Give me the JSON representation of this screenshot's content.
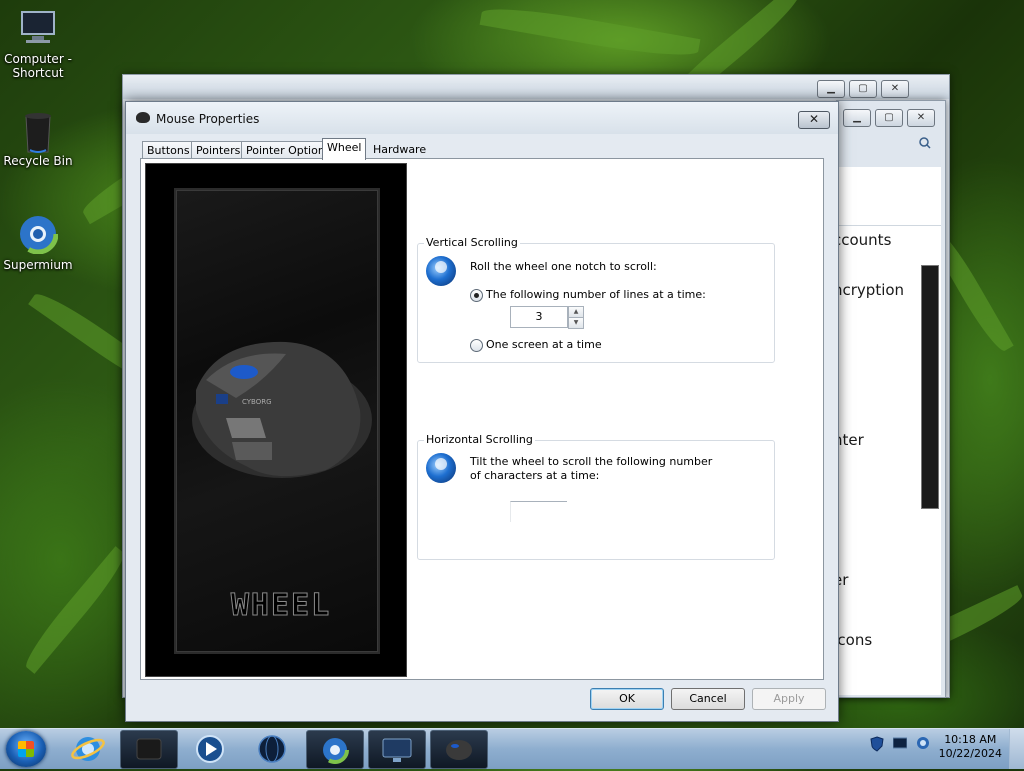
{
  "desktop": {
    "icons": [
      {
        "label": "Computer - Shortcut",
        "icon": "computer-icon"
      },
      {
        "label": "Recycle Bin",
        "icon": "recycle-bin-icon"
      },
      {
        "label": "Supermium",
        "icon": "supermium-icon"
      }
    ]
  },
  "background_window": {
    "visible_fragments": [
      "ccounts",
      "ncryption",
      "nter",
      "er",
      "Icons"
    ]
  },
  "dialog": {
    "title": "Mouse Properties",
    "close_label": "✕",
    "tabs": [
      "Buttons",
      "Pointers",
      "Pointer Options",
      "Wheel",
      "Hardware"
    ],
    "active_tab": "Wheel",
    "banner_text": "WHEEL",
    "vertical": {
      "group_label": "Vertical Scrolling",
      "instruction": "Roll the wheel one notch to scroll:",
      "option_lines": "The following number of lines at a time:",
      "lines_value": "3",
      "option_screen": "One screen at a time",
      "selected": "lines"
    },
    "horizontal": {
      "group_label": "Horizontal Scrolling",
      "instruction_line1": "Tilt the wheel to scroll the following number",
      "instruction_line2": "of characters at a time:",
      "chars_value": ""
    },
    "buttons": {
      "ok": "OK",
      "cancel": "Cancel",
      "apply": "Apply"
    }
  },
  "taskbar": {
    "pinned": [
      "ie-icon"
    ],
    "items": [
      "black-box-app-icon",
      "media-player-icon",
      "globe-icon",
      "supermium-icon",
      "monitor-app-icon",
      "mouse-properties-icon"
    ],
    "tray": [
      "shield-icon",
      "display-icon",
      "network-icon"
    ],
    "time": "10:18 AM",
    "date": "10/22/2024"
  }
}
